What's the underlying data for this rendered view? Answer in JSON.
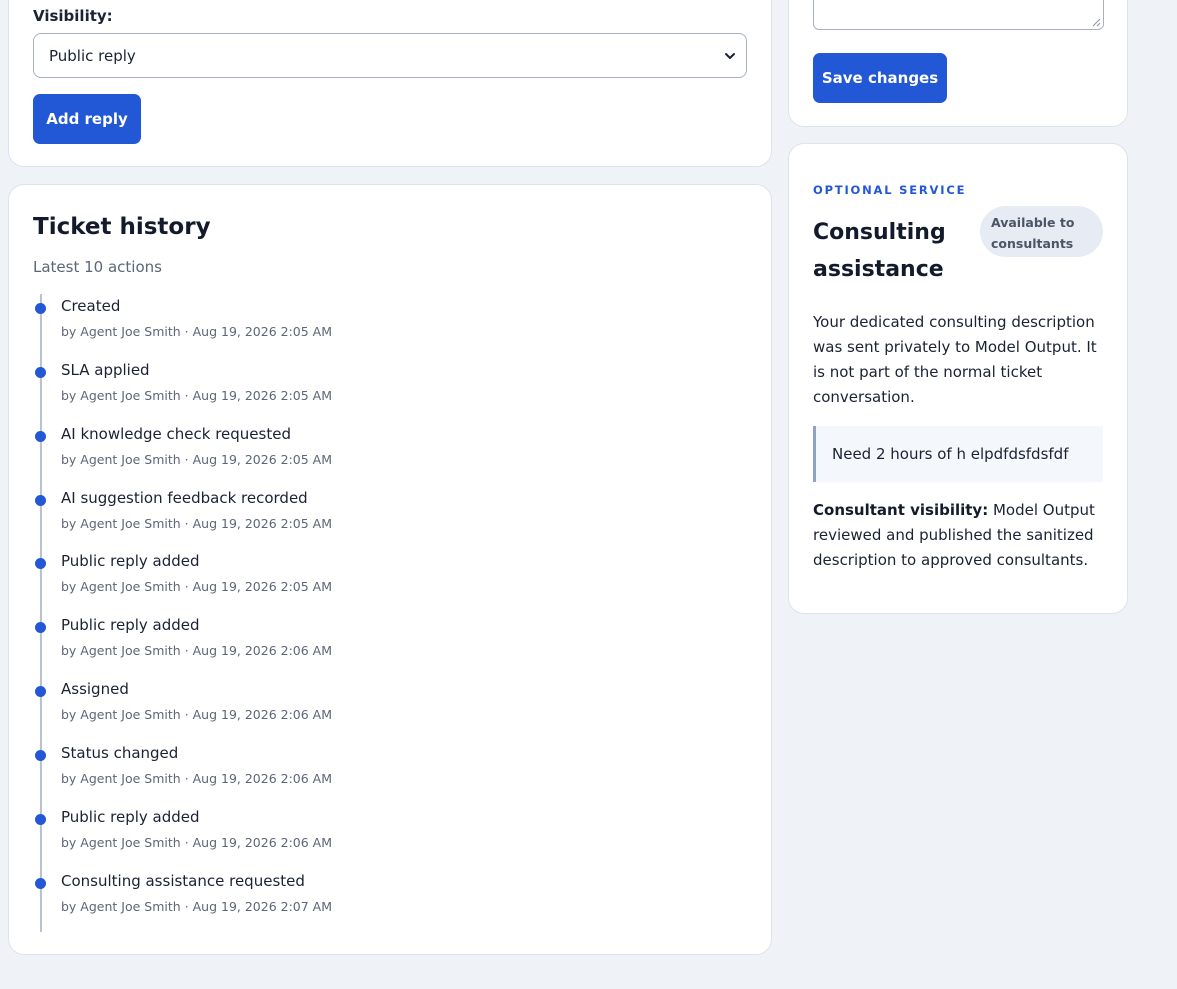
{
  "reply_form": {
    "visibility_label": "Visibility:",
    "visibility_value": "Public reply",
    "add_reply_label": "Add reply"
  },
  "history": {
    "title": "Ticket history",
    "subtitle": "Latest 10 actions",
    "events": [
      {
        "title": "Created",
        "meta": "by Agent Joe Smith · Aug 19, 2026 2:05 AM"
      },
      {
        "title": "SLA applied",
        "meta": "by Agent Joe Smith · Aug 19, 2026 2:05 AM"
      },
      {
        "title": "AI knowledge check requested",
        "meta": "by Agent Joe Smith · Aug 19, 2026 2:05 AM"
      },
      {
        "title": "AI suggestion feedback recorded",
        "meta": "by Agent Joe Smith · Aug 19, 2026 2:05 AM"
      },
      {
        "title": "Public reply added",
        "meta": "by Agent Joe Smith · Aug 19, 2026 2:05 AM"
      },
      {
        "title": "Public reply added",
        "meta": "by Agent Joe Smith · Aug 19, 2026 2:06 AM"
      },
      {
        "title": "Assigned",
        "meta": "by Agent Joe Smith · Aug 19, 2026 2:06 AM"
      },
      {
        "title": "Status changed",
        "meta": "by Agent Joe Smith · Aug 19, 2026 2:06 AM"
      },
      {
        "title": "Public reply added",
        "meta": "by Agent Joe Smith · Aug 19, 2026 2:06 AM"
      },
      {
        "title": "Consulting assistance requested",
        "meta": "by Agent Joe Smith · Aug 19, 2026 2:07 AM"
      }
    ]
  },
  "save_form": {
    "save_label": "Save changes"
  },
  "consulting": {
    "eyebrow": "OPTIONAL SERVICE",
    "title": "Consulting assistance",
    "badge": "Available to consultants",
    "description": "Your dedicated consulting description was sent privately to Model Output. It is not part of the normal ticket conversation.",
    "quote": "Need 2 hours of h elpdfdsfdsfdf",
    "visibility_label": "Consultant visibility:",
    "visibility_text": "Model Output reviewed and published the sanitized description to approved consultants."
  },
  "colors": {
    "accent": "#2257d6",
    "page_background": "#eff3f8",
    "badge_background": "#e7ecf4"
  }
}
